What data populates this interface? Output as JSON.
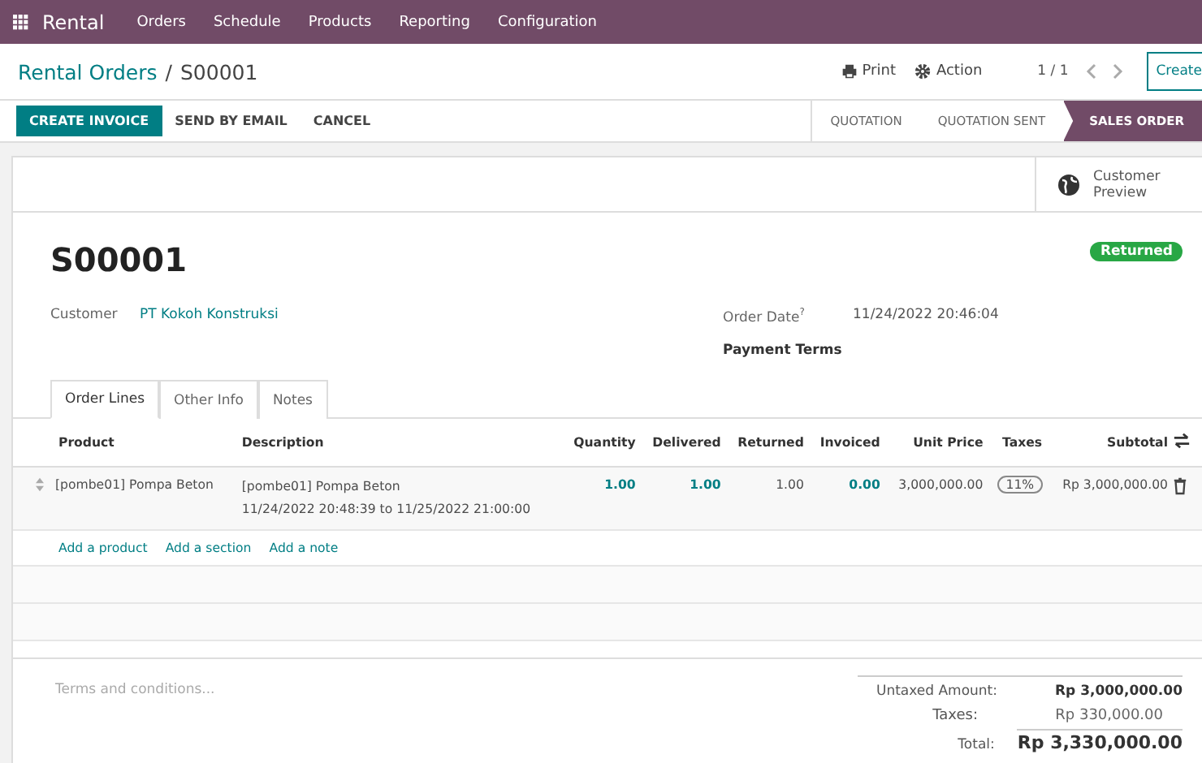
{
  "navbar": {
    "app": "Rental",
    "menu": [
      "Orders",
      "Schedule",
      "Products",
      "Reporting",
      "Configuration"
    ]
  },
  "breadcrumb": {
    "parent": "Rental Orders",
    "separator": "/",
    "current": "S00001"
  },
  "control_panel": {
    "print": "Print",
    "action": "Action",
    "pager": "1 / 1",
    "create": "Create"
  },
  "action_buttons": [
    {
      "label": "CREATE INVOICE",
      "primary": true
    },
    {
      "label": "SEND BY EMAIL",
      "primary": false
    },
    {
      "label": "CANCEL",
      "primary": false
    }
  ],
  "status_stages": [
    {
      "label": "QUOTATION",
      "selected": false
    },
    {
      "label": "QUOTATION SENT",
      "selected": false
    },
    {
      "label": "SALES ORDER",
      "selected": true
    }
  ],
  "customer_preview": {
    "line_1": "Customer",
    "line_2": "Preview"
  },
  "record": {
    "name": "S00001",
    "badge": "Returned",
    "customer_label": "Customer",
    "customer": "PT Kokoh Konstruksi",
    "order_date_label": "Order Date",
    "order_date_help": "?",
    "order_date": "11/24/2022 20:46:04",
    "payment_terms_label": "Payment Terms"
  },
  "tabs": [
    {
      "label": "Order Lines",
      "selected": true
    },
    {
      "label": "Other Info",
      "selected": false
    },
    {
      "label": "Notes",
      "selected": false
    }
  ],
  "table": {
    "columns": [
      "Product",
      "Description",
      "Quantity",
      "Delivered",
      "Returned",
      "Invoiced",
      "Unit Price",
      "Taxes",
      "Subtotal"
    ],
    "rows": [
      {
        "product": "[pombe01] Pompa Beton",
        "description": "[pombe01] Pompa Beton",
        "period": "11/24/2022 20:48:39 to 11/25/2022 21:00:00",
        "quantity": "1.00",
        "delivered": "1.00",
        "returned": "1.00",
        "invoiced": "0.00",
        "unit_price": "3,000,000.00",
        "tax": "11%",
        "subtotal": "Rp 3,000,000.00"
      }
    ],
    "add_links": [
      "Add a product",
      "Add a section",
      "Add a note"
    ]
  },
  "terms": {
    "placeholder": "Terms and conditions..."
  },
  "totals": [
    {
      "label": "Untaxed Amount:",
      "value": "Rp 3,000,000.00",
      "kind": "subtotal"
    },
    {
      "label": "Taxes:",
      "value": "Rp 330,000.00",
      "kind": "plain"
    },
    {
      "label": "Total:",
      "value": "Rp 3,330,000.00",
      "kind": "total"
    }
  ]
}
